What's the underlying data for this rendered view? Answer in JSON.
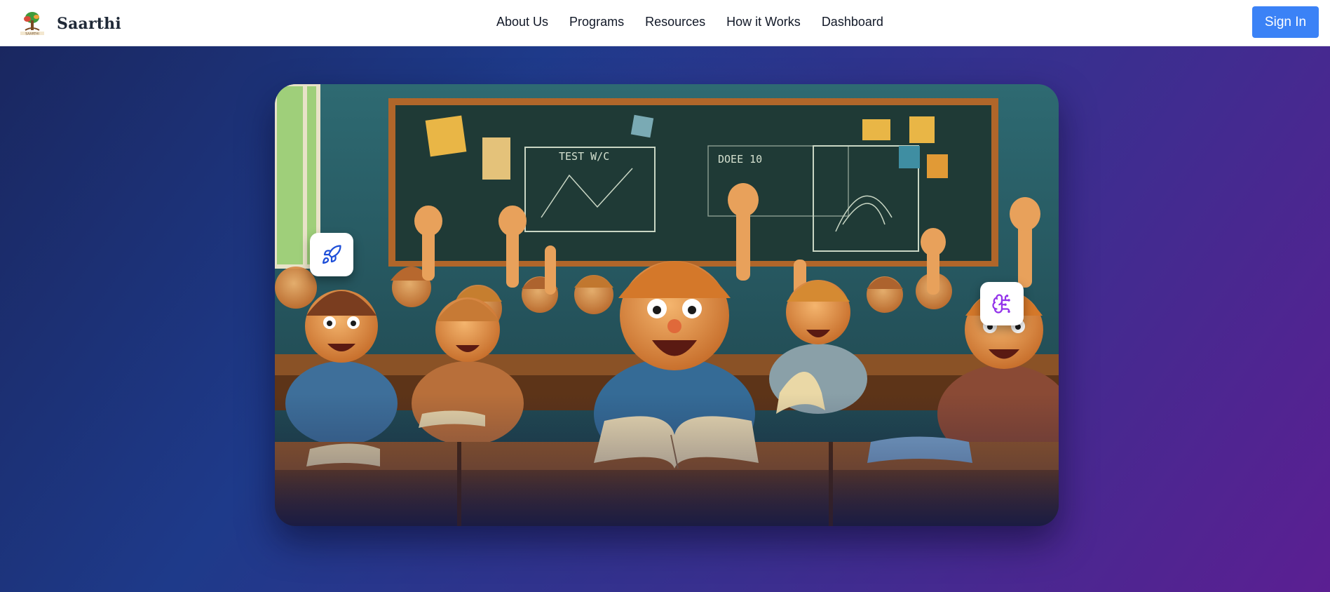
{
  "header": {
    "brand_name": "Saarthi",
    "logo_icon": "tree-logo-icon",
    "nav_links": [
      "About Us",
      "Programs",
      "Resources",
      "How it Works",
      "Dashboard"
    ],
    "sign_in_label": "Sign In"
  },
  "hero": {
    "image_description_icon": "classroom-illustration",
    "badges": [
      {
        "icon": "rocket-icon",
        "color": "#1d4ed8"
      },
      {
        "icon": "brain-icon",
        "color": "#9333ea"
      }
    ],
    "carousel": {
      "slide_count": 4,
      "active_index": 2
    }
  },
  "colors": {
    "accent": "#3b82f6",
    "active_dot": "#f4c21a",
    "hero_start": "#1a2760",
    "hero_end": "#5b1f92"
  }
}
